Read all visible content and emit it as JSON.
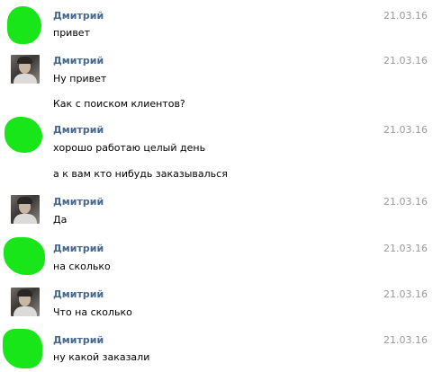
{
  "messages": [
    {
      "author": "Дмитрий",
      "date": "21.03.16",
      "lines": [
        "привет"
      ],
      "avatar": "scribbled"
    },
    {
      "author": "Дмитрий",
      "date": "21.03.16",
      "lines": [
        "Ну привет",
        "Как с поиском клиентов?"
      ],
      "avatar": "photo"
    },
    {
      "author": "Дмитрий",
      "date": "21.03.16",
      "lines": [
        "хорошо работаю целый день",
        "а к вам кто нибудь заказывалься"
      ],
      "avatar": "scribbled"
    },
    {
      "author": "Дмитрий",
      "date": "21.03.16",
      "lines": [
        "Да"
      ],
      "avatar": "photo"
    },
    {
      "author": "Дмитрий",
      "date": "21.03.16",
      "lines": [
        "на сколько"
      ],
      "avatar": "scribbled"
    },
    {
      "author": "Дмитрий",
      "date": "21.03.16",
      "lines": [
        "Что на сколько"
      ],
      "avatar": "photo"
    },
    {
      "author": "Дмитрий",
      "date": "21.03.16",
      "lines": [
        "ну какой заказали"
      ],
      "avatar": "scribbled"
    }
  ],
  "colors": {
    "author": "#45688e",
    "date": "#999999",
    "scribble": "#19e619"
  }
}
